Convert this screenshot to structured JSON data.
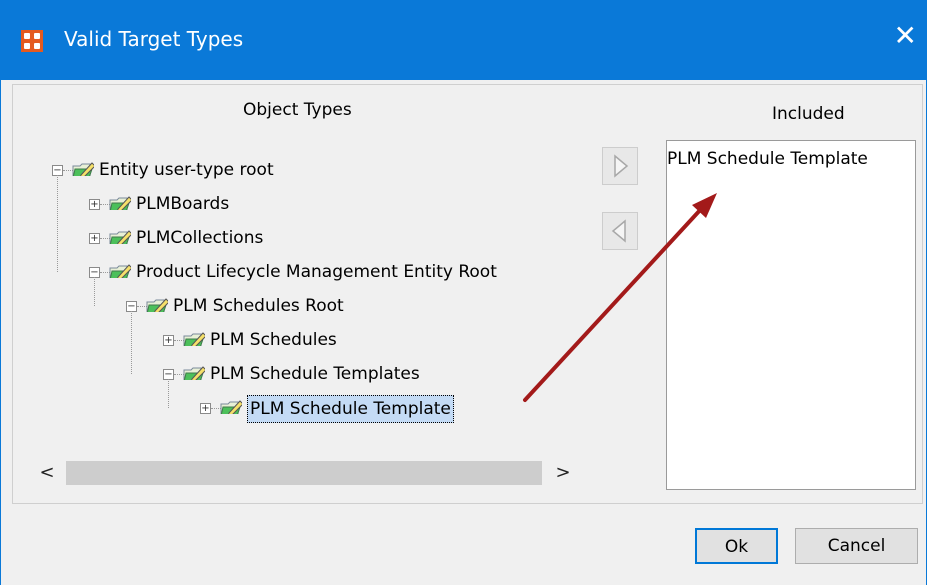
{
  "window": {
    "title": "Valid Target Types",
    "close_glyph": "✕",
    "app_icon": "app-grid-icon"
  },
  "labels": {
    "object_types": "Object Types",
    "included": "Included"
  },
  "tree": [
    {
      "label": "Entity user-type root",
      "expander": "−",
      "level": 0
    },
    {
      "label": "PLMBoards",
      "expander": "+",
      "level": 1
    },
    {
      "label": "PLMCollections",
      "expander": "+",
      "level": 1
    },
    {
      "label": "Product Lifecycle Management Entity Root",
      "expander": "−",
      "level": 1
    },
    {
      "label": "PLM Schedules Root",
      "expander": "−",
      "level": 2
    },
    {
      "label": "PLM Schedules",
      "expander": "+",
      "level": 3
    },
    {
      "label": "PLM Schedule Templates",
      "expander": "−",
      "level": 3
    },
    {
      "label": "PLM Schedule Template",
      "expander": "+",
      "level": 4,
      "selected": true
    }
  ],
  "included_items": [
    "PLM Schedule Template"
  ],
  "transfer": {
    "add_glyph": "▷",
    "remove_glyph": "◁"
  },
  "scrollbar": {
    "left_glyph": "<",
    "right_glyph": ">"
  },
  "buttons": {
    "ok": "Ok",
    "cancel": "Cancel"
  },
  "colors": {
    "titlebar": "#0a79d8",
    "selection": "#c4dbf5",
    "annotation_arrow": "#a31a1a"
  }
}
